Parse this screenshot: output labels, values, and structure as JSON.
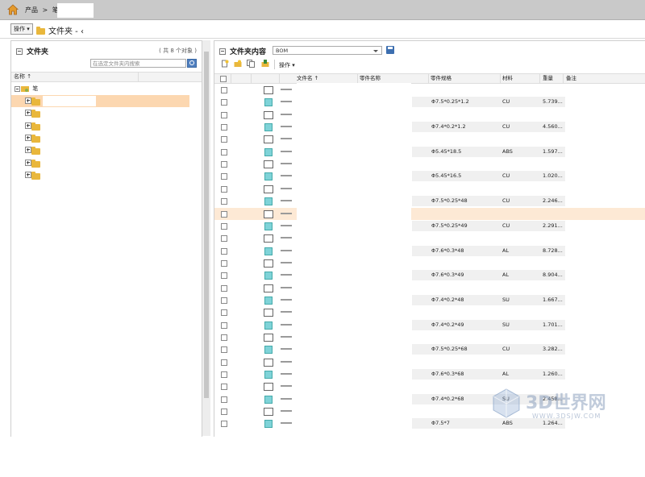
{
  "breadcrumb": {
    "items": [
      "产品",
      ">",
      "笔",
      ">"
    ]
  },
  "toolbar": {
    "actions_label": "操作 ▾",
    "title": "文件夹 -",
    "title_suffix": "‹"
  },
  "left": {
    "title": "文件夹",
    "count": "( 共 8 个对象 )",
    "search_placeholder": "在选定文件夹内搜索",
    "col_name": "名称",
    "sort_indicator": "↑",
    "root_label": "笔",
    "rows": 7
  },
  "right": {
    "title": "文件夹内容",
    "view_value": "BOM",
    "ops_label": "操作 ▾",
    "columns": {
      "filename": "文件名",
      "sort": "↑",
      "partname": "零件名称",
      "spec": "零件规格",
      "material": "材料",
      "weight": "重量",
      "note": "备注"
    },
    "rows": [
      {
        "kind": "img",
        "spec": "",
        "mat": "",
        "wt": ""
      },
      {
        "kind": "part",
        "spec": "Φ7.5*0.25*1.2",
        "mat": "CU",
        "wt": "5.739..."
      },
      {
        "kind": "img",
        "spec": "",
        "mat": "",
        "wt": ""
      },
      {
        "kind": "part",
        "spec": "Φ7.4*0.2*1.2",
        "mat": "CU",
        "wt": "4.560..."
      },
      {
        "kind": "img",
        "spec": "",
        "mat": "",
        "wt": ""
      },
      {
        "kind": "part",
        "spec": "Φ5.45*18.5",
        "mat": "ABS",
        "wt": "1.597..."
      },
      {
        "kind": "img",
        "spec": "",
        "mat": "",
        "wt": ""
      },
      {
        "kind": "part",
        "spec": "Φ5.45*16.5",
        "mat": "CU",
        "wt": "1.020..."
      },
      {
        "kind": "img",
        "spec": "",
        "mat": "",
        "wt": ""
      },
      {
        "kind": "part",
        "spec": "Φ7.5*0.25*48",
        "mat": "CU",
        "wt": "2.246..."
      },
      {
        "kind": "img",
        "spec": "",
        "mat": "",
        "wt": "",
        "selected": true
      },
      {
        "kind": "part",
        "spec": "Φ7.5*0.25*49",
        "mat": "CU",
        "wt": "2.291..."
      },
      {
        "kind": "img",
        "spec": "",
        "mat": "",
        "wt": ""
      },
      {
        "kind": "part",
        "spec": "Φ7.6*0.3*48",
        "mat": "AL",
        "wt": "8.728..."
      },
      {
        "kind": "img",
        "spec": "",
        "mat": "",
        "wt": ""
      },
      {
        "kind": "part",
        "spec": "Φ7.6*0.3*49",
        "mat": "AL",
        "wt": "8.904..."
      },
      {
        "kind": "img",
        "spec": "",
        "mat": "",
        "wt": ""
      },
      {
        "kind": "part",
        "spec": "Φ7.4*0.2*48",
        "mat": "SU",
        "wt": "1.667..."
      },
      {
        "kind": "img",
        "spec": "",
        "mat": "",
        "wt": ""
      },
      {
        "kind": "part",
        "spec": "Φ7.4*0.2*49",
        "mat": "SU",
        "wt": "1.701..."
      },
      {
        "kind": "img",
        "spec": "",
        "mat": "",
        "wt": ""
      },
      {
        "kind": "part",
        "spec": "Φ7.5*0.25*68",
        "mat": "CU",
        "wt": "3.282..."
      },
      {
        "kind": "img",
        "spec": "",
        "mat": "",
        "wt": ""
      },
      {
        "kind": "part",
        "spec": "Φ7.6*0.3*68",
        "mat": "AL",
        "wt": "1.260..."
      },
      {
        "kind": "img",
        "spec": "",
        "mat": "",
        "wt": ""
      },
      {
        "kind": "part",
        "spec": "Φ7.4*0.2*68",
        "mat": "SU",
        "wt": "2.458..."
      },
      {
        "kind": "img",
        "spec": "",
        "mat": "",
        "wt": ""
      },
      {
        "kind": "part",
        "spec": "Φ7.5*7",
        "mat": "ABS",
        "wt": "1.264..."
      }
    ]
  },
  "watermark": {
    "text": "3D世界网",
    "url": "WWW.3DSJW.COM"
  },
  "colors": {
    "topbar": "#c9c9c9",
    "selected_row": "#fde9d5",
    "folder": "#e9b73c",
    "accent": "#3d6fb0"
  }
}
